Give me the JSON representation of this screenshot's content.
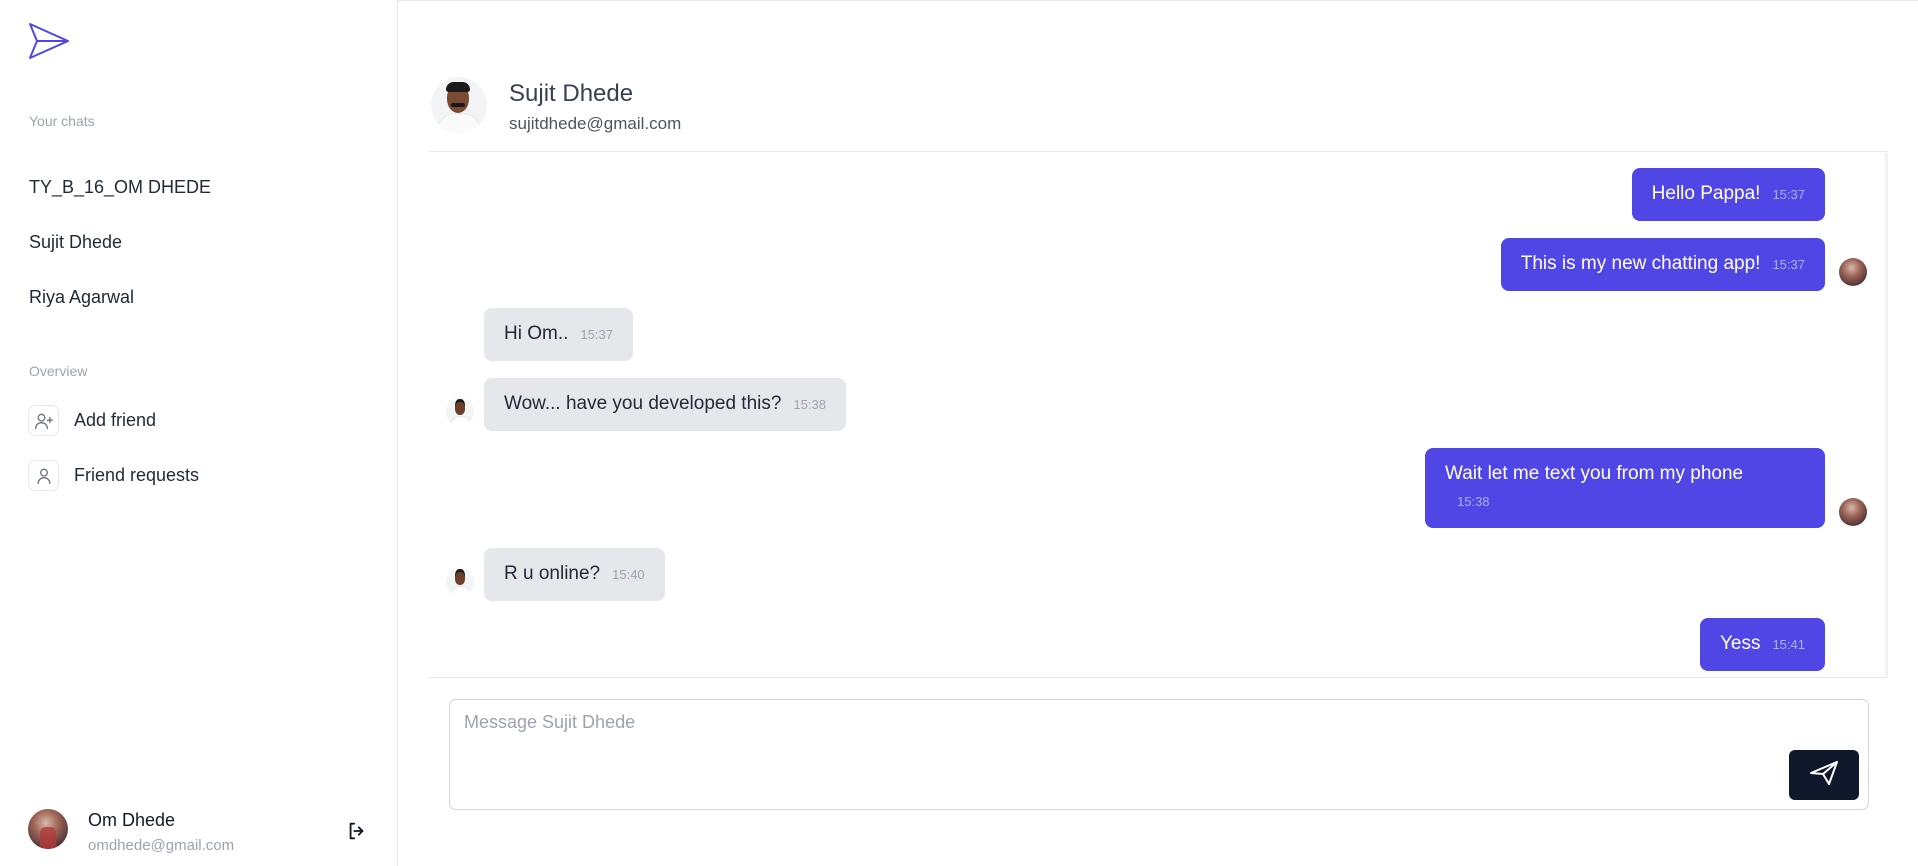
{
  "app": {
    "brand_icon": "send-icon",
    "accent": "#4f46e5"
  },
  "sidebar": {
    "chats_label": "Your chats",
    "chats": [
      {
        "name": "TY_B_16_OM DHEDE"
      },
      {
        "name": "Sujit Dhede"
      },
      {
        "name": "Riya Agarwal"
      }
    ],
    "overview_label": "Overview",
    "overview": [
      {
        "label": "Add friend",
        "icon": "user-plus-icon"
      },
      {
        "label": "Friend requests",
        "icon": "user-icon"
      }
    ],
    "profile": {
      "name": "Om Dhede",
      "email": "omdhede@gmail.com"
    }
  },
  "chat": {
    "name": "Sujit Dhede",
    "email": "sujitdhede@gmail.com",
    "messages": [
      {
        "from": "me",
        "text": "Hello Pappa!",
        "time": "15:37"
      },
      {
        "from": "me",
        "text": "This is my new chatting app!",
        "time": "15:37"
      },
      {
        "from": "them",
        "text": "Hi Om..",
        "time": "15:37"
      },
      {
        "from": "them",
        "text": "Wow... have you developed this?",
        "time": "15:38"
      },
      {
        "from": "me",
        "text": "Wait let me text you from my phone",
        "time": "15:38"
      },
      {
        "from": "them",
        "text": "R u online?",
        "time": "15:40"
      },
      {
        "from": "me",
        "text": "Yess",
        "time": "15:41"
      }
    ],
    "composer": {
      "placeholder": "Message Sujit Dhede",
      "value": ""
    }
  }
}
